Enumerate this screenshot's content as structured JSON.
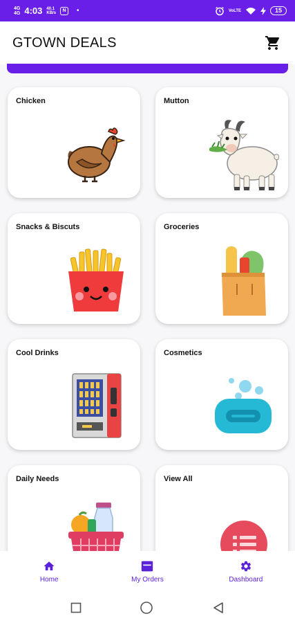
{
  "status_bar": {
    "net1": "4G",
    "net2": "4G",
    "time": "4:03",
    "speed": "40.1",
    "speed_unit": "KB/s",
    "badge": "N",
    "volte": "VoLTE",
    "battery": "15"
  },
  "app_bar": {
    "title": "GTOWN DEALS",
    "cart_icon": "cart-icon"
  },
  "categories": [
    {
      "label": "Chicken",
      "icon": "chicken-icon"
    },
    {
      "label": "Mutton",
      "icon": "goat-icon"
    },
    {
      "label": "Snacks & Biscuts",
      "icon": "fries-icon"
    },
    {
      "label": "Groceries",
      "icon": "grocery-bag-icon"
    },
    {
      "label": "Cool Drinks",
      "icon": "vending-machine-icon"
    },
    {
      "label": "Cosmetics",
      "icon": "soap-icon"
    },
    {
      "label": "Daily Needs",
      "icon": "basket-icon"
    },
    {
      "label": "View All",
      "icon": "list-icon"
    }
  ],
  "bottom_nav": [
    {
      "label": "Home",
      "icon": "home-icon"
    },
    {
      "label": "My Orders",
      "icon": "orders-icon"
    },
    {
      "label": "Dashboard",
      "icon": "gear-icon"
    }
  ],
  "colors": {
    "primary": "#6a1fe8",
    "nav_text": "#5b21d9"
  }
}
